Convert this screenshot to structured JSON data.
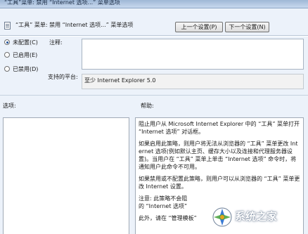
{
  "window": {
    "title": "“工具”菜单: 禁用 “Internet 选项...” 菜单选项"
  },
  "header": {
    "policy_title": "“工具” 菜单: 禁用 “Internet 选项...” 菜单选项",
    "prev_button": "上一个设置(P)",
    "next_button": "下一个设置(N)"
  },
  "state": {
    "options": [
      {
        "label": "未配置(C)",
        "checked": true
      },
      {
        "label": "已启用(E)",
        "checked": false
      },
      {
        "label": "已禁用(D)",
        "checked": false
      }
    ]
  },
  "comment": {
    "label": "注释:",
    "value": ""
  },
  "supported": {
    "label": "支持的平台:",
    "value": "至少 Internet Explorer 5.0"
  },
  "options_pane": {
    "label": "选项:"
  },
  "help_pane": {
    "label": "帮助:",
    "paragraphs": [
      "阻止用户从 Microsoft Internet Explorer 中的 “工具” 菜单打开 “Internet 选项” 对话框。",
      "如果启用此策略，则用户将无法从浏览器的 “工具” 菜单更改 Internet 选项(例如默认主页、缓存大小以及连接和代理服务器设置)。当用户在 “工具” 菜单上单击 “Internet 选项” 命令时，将通知用户此命令不可用。",
      "如果禁用或不配置此策略，则用户可以从浏览器的 “工具” 菜单更改 Internet 设置。",
      "注意: 此策略不会阻",
      "的 “Internet 选项”",
      "此外，请在 “管理模板”"
    ]
  },
  "watermark": {
    "text": "系统之家"
  }
}
